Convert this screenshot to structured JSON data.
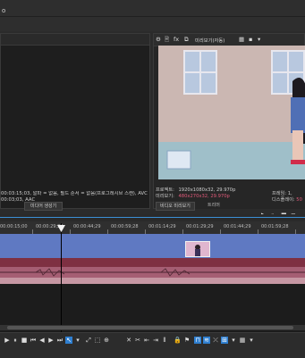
{
  "topbar": {
    "fragment": "o"
  },
  "left_panel": {
    "info_line1": "00:03:15;03, 알파 = 없음, 필드 순서 = 없음(프로그레시브 스캔), AVC",
    "info_line2": "00:03;03, AAC",
    "tab_label": "미디어 생성기"
  },
  "preview": {
    "toolbar": {
      "gear": "⚙",
      "icon2": "🖹",
      "icon3": "fx",
      "icon4": "⧉",
      "label": "미리보기(자동)",
      "grid": "▦",
      "icon6": "▪",
      "icon7": "▾"
    },
    "project_label": "프로젝트:",
    "project_value": "1920x1080x32, 29.970p",
    "preview_label": "미리보기:",
    "preview_value": "480x270x32, 29.970p",
    "tab_label": "비디오 미리보기",
    "tab2_label": "트리머",
    "frame_label": "프레임:",
    "frame_value": "1,",
    "display_label": "디스플레이:",
    "display_value": "50"
  },
  "timeline": {
    "ticks": [
      "00:00:15;00",
      "00:00:29;29",
      "00:00:44;29",
      "00:00:59;28",
      "00:01:14;29",
      "00:01:29;29",
      "00:01:44;29",
      "00:01:59;28"
    ]
  },
  "colors": {
    "track_video": "#5f79c2",
    "track_audio": "#7e3042",
    "accent": "#2f7fd0"
  }
}
